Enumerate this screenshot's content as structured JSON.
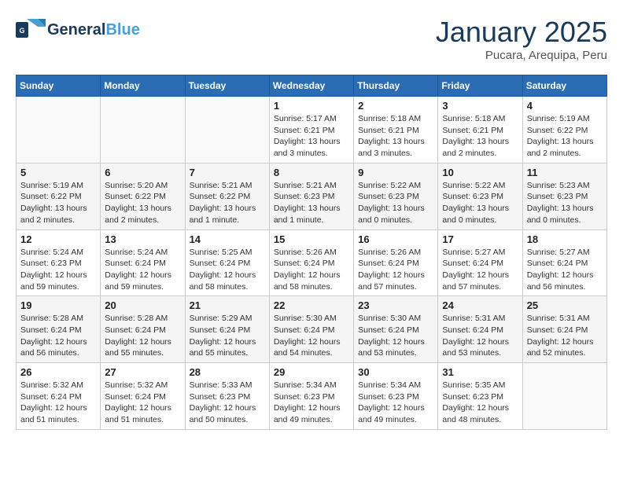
{
  "header": {
    "logo_general": "General",
    "logo_blue": "Blue",
    "logo_tagline": "",
    "cal_title": "January 2025",
    "cal_location": "Pucara, Arequipa, Peru"
  },
  "days_of_week": [
    "Sunday",
    "Monday",
    "Tuesday",
    "Wednesday",
    "Thursday",
    "Friday",
    "Saturday"
  ],
  "weeks": [
    [
      {
        "num": "",
        "info": ""
      },
      {
        "num": "",
        "info": ""
      },
      {
        "num": "",
        "info": ""
      },
      {
        "num": "1",
        "info": "Sunrise: 5:17 AM\nSunset: 6:21 PM\nDaylight: 13 hours\nand 3 minutes."
      },
      {
        "num": "2",
        "info": "Sunrise: 5:18 AM\nSunset: 6:21 PM\nDaylight: 13 hours\nand 3 minutes."
      },
      {
        "num": "3",
        "info": "Sunrise: 5:18 AM\nSunset: 6:21 PM\nDaylight: 13 hours\nand 2 minutes."
      },
      {
        "num": "4",
        "info": "Sunrise: 5:19 AM\nSunset: 6:22 PM\nDaylight: 13 hours\nand 2 minutes."
      }
    ],
    [
      {
        "num": "5",
        "info": "Sunrise: 5:19 AM\nSunset: 6:22 PM\nDaylight: 13 hours\nand 2 minutes."
      },
      {
        "num": "6",
        "info": "Sunrise: 5:20 AM\nSunset: 6:22 PM\nDaylight: 13 hours\nand 2 minutes."
      },
      {
        "num": "7",
        "info": "Sunrise: 5:21 AM\nSunset: 6:22 PM\nDaylight: 13 hours\nand 1 minute."
      },
      {
        "num": "8",
        "info": "Sunrise: 5:21 AM\nSunset: 6:23 PM\nDaylight: 13 hours\nand 1 minute."
      },
      {
        "num": "9",
        "info": "Sunrise: 5:22 AM\nSunset: 6:23 PM\nDaylight: 13 hours\nand 0 minutes."
      },
      {
        "num": "10",
        "info": "Sunrise: 5:22 AM\nSunset: 6:23 PM\nDaylight: 13 hours\nand 0 minutes."
      },
      {
        "num": "11",
        "info": "Sunrise: 5:23 AM\nSunset: 6:23 PM\nDaylight: 13 hours\nand 0 minutes."
      }
    ],
    [
      {
        "num": "12",
        "info": "Sunrise: 5:24 AM\nSunset: 6:23 PM\nDaylight: 12 hours\nand 59 minutes."
      },
      {
        "num": "13",
        "info": "Sunrise: 5:24 AM\nSunset: 6:24 PM\nDaylight: 12 hours\nand 59 minutes."
      },
      {
        "num": "14",
        "info": "Sunrise: 5:25 AM\nSunset: 6:24 PM\nDaylight: 12 hours\nand 58 minutes."
      },
      {
        "num": "15",
        "info": "Sunrise: 5:26 AM\nSunset: 6:24 PM\nDaylight: 12 hours\nand 58 minutes."
      },
      {
        "num": "16",
        "info": "Sunrise: 5:26 AM\nSunset: 6:24 PM\nDaylight: 12 hours\nand 57 minutes."
      },
      {
        "num": "17",
        "info": "Sunrise: 5:27 AM\nSunset: 6:24 PM\nDaylight: 12 hours\nand 57 minutes."
      },
      {
        "num": "18",
        "info": "Sunrise: 5:27 AM\nSunset: 6:24 PM\nDaylight: 12 hours\nand 56 minutes."
      }
    ],
    [
      {
        "num": "19",
        "info": "Sunrise: 5:28 AM\nSunset: 6:24 PM\nDaylight: 12 hours\nand 56 minutes."
      },
      {
        "num": "20",
        "info": "Sunrise: 5:28 AM\nSunset: 6:24 PM\nDaylight: 12 hours\nand 55 minutes."
      },
      {
        "num": "21",
        "info": "Sunrise: 5:29 AM\nSunset: 6:24 PM\nDaylight: 12 hours\nand 55 minutes."
      },
      {
        "num": "22",
        "info": "Sunrise: 5:30 AM\nSunset: 6:24 PM\nDaylight: 12 hours\nand 54 minutes."
      },
      {
        "num": "23",
        "info": "Sunrise: 5:30 AM\nSunset: 6:24 PM\nDaylight: 12 hours\nand 53 minutes."
      },
      {
        "num": "24",
        "info": "Sunrise: 5:31 AM\nSunset: 6:24 PM\nDaylight: 12 hours\nand 53 minutes."
      },
      {
        "num": "25",
        "info": "Sunrise: 5:31 AM\nSunset: 6:24 PM\nDaylight: 12 hours\nand 52 minutes."
      }
    ],
    [
      {
        "num": "26",
        "info": "Sunrise: 5:32 AM\nSunset: 6:24 PM\nDaylight: 12 hours\nand 51 minutes."
      },
      {
        "num": "27",
        "info": "Sunrise: 5:32 AM\nSunset: 6:24 PM\nDaylight: 12 hours\nand 51 minutes."
      },
      {
        "num": "28",
        "info": "Sunrise: 5:33 AM\nSunset: 6:23 PM\nDaylight: 12 hours\nand 50 minutes."
      },
      {
        "num": "29",
        "info": "Sunrise: 5:34 AM\nSunset: 6:23 PM\nDaylight: 12 hours\nand 49 minutes."
      },
      {
        "num": "30",
        "info": "Sunrise: 5:34 AM\nSunset: 6:23 PM\nDaylight: 12 hours\nand 49 minutes."
      },
      {
        "num": "31",
        "info": "Sunrise: 5:35 AM\nSunset: 6:23 PM\nDaylight: 12 hours\nand 48 minutes."
      },
      {
        "num": "",
        "info": ""
      }
    ]
  ]
}
